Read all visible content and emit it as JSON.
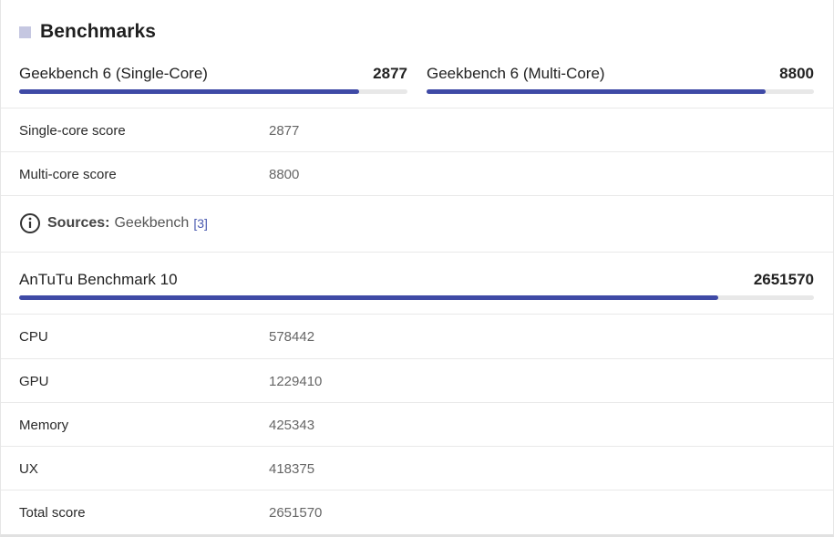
{
  "section": {
    "title": "Benchmarks"
  },
  "geekbench": [
    {
      "name": "Geekbench 6 (Single-Core)",
      "score": "2877",
      "fill": 0.875
    },
    {
      "name": "Geekbench 6 (Multi-Core)",
      "score": "8800",
      "fill": 0.875
    }
  ],
  "geekbench_rows": [
    {
      "label": "Single-core score",
      "value": "2877"
    },
    {
      "label": "Multi-core score",
      "value": "8800"
    }
  ],
  "sources": {
    "key": "Sources:",
    "value": "Geekbench",
    "ref": "[3]"
  },
  "antutu": {
    "name": "AnTuTu Benchmark 10",
    "score": "2651570",
    "fill": 0.88
  },
  "antutu_rows": [
    {
      "label": "CPU",
      "value": "578442"
    },
    {
      "label": "GPU",
      "value": "1229410"
    },
    {
      "label": "Memory",
      "value": "425343"
    },
    {
      "label": "UX",
      "value": "418375"
    },
    {
      "label": "Total score",
      "value": "2651570"
    }
  ],
  "colors": {
    "bar_fill": "#3f4aa6",
    "bar_track": "#e8e8e8",
    "title_square": "#c5c7e1"
  }
}
